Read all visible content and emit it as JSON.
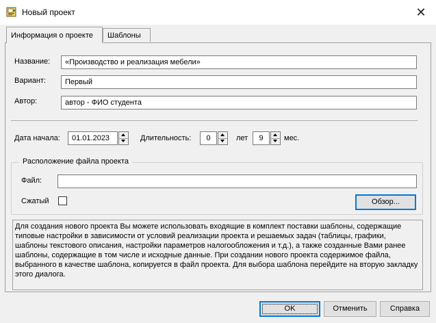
{
  "window": {
    "title": "Новый проект",
    "icon": "project-document-icon",
    "close_glyph": "✕"
  },
  "tabs": [
    {
      "label": "Информация о проекте",
      "active": true
    },
    {
      "label": "Шаблоны",
      "active": false
    }
  ],
  "project": {
    "name_label": "Название:",
    "name_value": "«Производство и реализация мебели»",
    "variant_label": "Вариант:",
    "variant_value": "Первый",
    "author_label": "Автор:",
    "author_value": "автор - ФИО студента"
  },
  "dates": {
    "start_label": "Дата начала:",
    "start_value": "01.01.2023",
    "duration_label": "Длительность:",
    "years_value": "0",
    "years_unit": "лет",
    "months_value": "9",
    "months_unit": "мес."
  },
  "file_location": {
    "group_title": "Расположение файла проекта",
    "file_label": "Файл:",
    "file_value": "",
    "compressed_label": "Сжатый",
    "compressed_checked": false,
    "browse_label": "Обзор..."
  },
  "info_text": "Для создания нового проекта Вы можете использовать входящие в комплект поставки шаблоны, содержащие типовые настройки в зависимости от условий реализации проекта и решаемых задач (таблицы, графики, шаблоны текстового описания, настройки параметров налогообложения и т.д.), а также созданные Вами ранее шаблоны, содержащие в том числе и исходные данные. При создании нового проекта содержимое файла, выбранного в качестве шаблона, копируется в файл проекта. Для выбора шаблона перейдите на вторую закладку этого диалога.",
  "footer": {
    "ok_label": "OK",
    "cancel_label": "Отменить",
    "help_label": "Справка"
  },
  "colors": {
    "dialog_bg": "#f0f0f0",
    "default_button_border": "#0078d7"
  }
}
